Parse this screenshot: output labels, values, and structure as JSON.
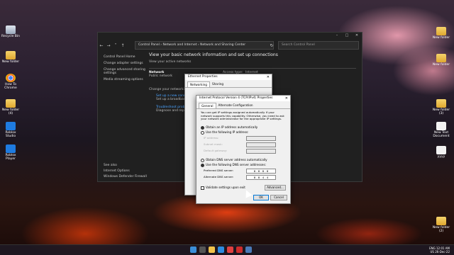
{
  "desktop": {
    "left_icons": [
      {
        "label": "Recycle Bin",
        "kind": "bin"
      },
      {
        "label": "New folder",
        "kind": "folder"
      },
      {
        "label": "How To Chrome",
        "kind": "chrome"
      },
      {
        "label": "New folder (4)",
        "kind": "folder"
      },
      {
        "label": "Roblox Studio",
        "kind": "roblox"
      },
      {
        "label": "Roblox Player",
        "kind": "roblox"
      }
    ],
    "right_icons": [
      {
        "label": "New folder",
        "kind": "folder"
      },
      {
        "label": "New folder",
        "kind": "folder"
      },
      {
        "label": "New folder (3)",
        "kind": "folder"
      },
      {
        "label": "New Text Document",
        "kind": "doc"
      },
      {
        "label": "yyyy",
        "kind": "doc"
      },
      {
        "label": "New folder (2)",
        "kind": "folder"
      }
    ]
  },
  "control_panel": {
    "breadcrumb": "Control Panel  ›  Network and Internet  ›  Network and Sharing Center",
    "search_placeholder": "Search Control Panel",
    "sidebar": [
      "Control Panel Home",
      "Change adapter settings",
      "Change advanced sharing settings",
      "Media streaming options"
    ],
    "see_also_title": "See also",
    "see_also": [
      "Internet Options",
      "Windows Defender Firewall"
    ],
    "heading": "View your basic network information and set up connections",
    "active_networks_label": "View your active networks",
    "network_name": "Network",
    "network_type": "Public network",
    "access_type_label": "Access type:",
    "access_type_value": "Internet",
    "change_settings_label": "Change your networking settings",
    "setup_link": "Set up a new connection or network",
    "setup_desc": "Set up a broadband, dial-up, or VPN connection; or set up a router or access point.",
    "troubleshoot_link": "Troubleshoot problems",
    "troubleshoot_desc": "Diagnose and repair network problems, or get troubleshooting information."
  },
  "ethernet_props": {
    "title": "Ethernet Properties",
    "tabs": [
      "Networking",
      "Sharing"
    ]
  },
  "ipv4": {
    "title": "Internet Protocol Version 4 (TCP/IPv4) Properties",
    "tabs": [
      "General",
      "Alternate Configuration"
    ],
    "info": "You can get IP settings assigned automatically if your network supports this capability. Otherwise, you need to ask your network administrator for the appropriate IP settings.",
    "ip_auto": "Obtain an IP address automatically",
    "ip_manual": "Use the following IP address:",
    "ip_fields": [
      "IP address:",
      "Subnet mask:",
      "Default gateway:"
    ],
    "dns_auto": "Obtain DNS server address automatically",
    "dns_manual": "Use the following DNS server addresses:",
    "preferred_dns_label": "Preferred DNS server:",
    "preferred_dns_value": "8 . 8 . 8 . 8",
    "alternate_dns_label": "Alternate DNS server:",
    "alternate_dns_value": "8 . 8 . 4 . 4",
    "validate_label": "Validate settings upon exit",
    "advanced_label": "Advanced...",
    "ok_label": "OK",
    "cancel_label": "Cancel"
  },
  "tray": {
    "lang": "ENG",
    "region": "US",
    "time": "12:01 AM",
    "date": "26-Dec-22"
  },
  "colors": {
    "accent": "#0078d7",
    "link": "#4aa3ff"
  }
}
